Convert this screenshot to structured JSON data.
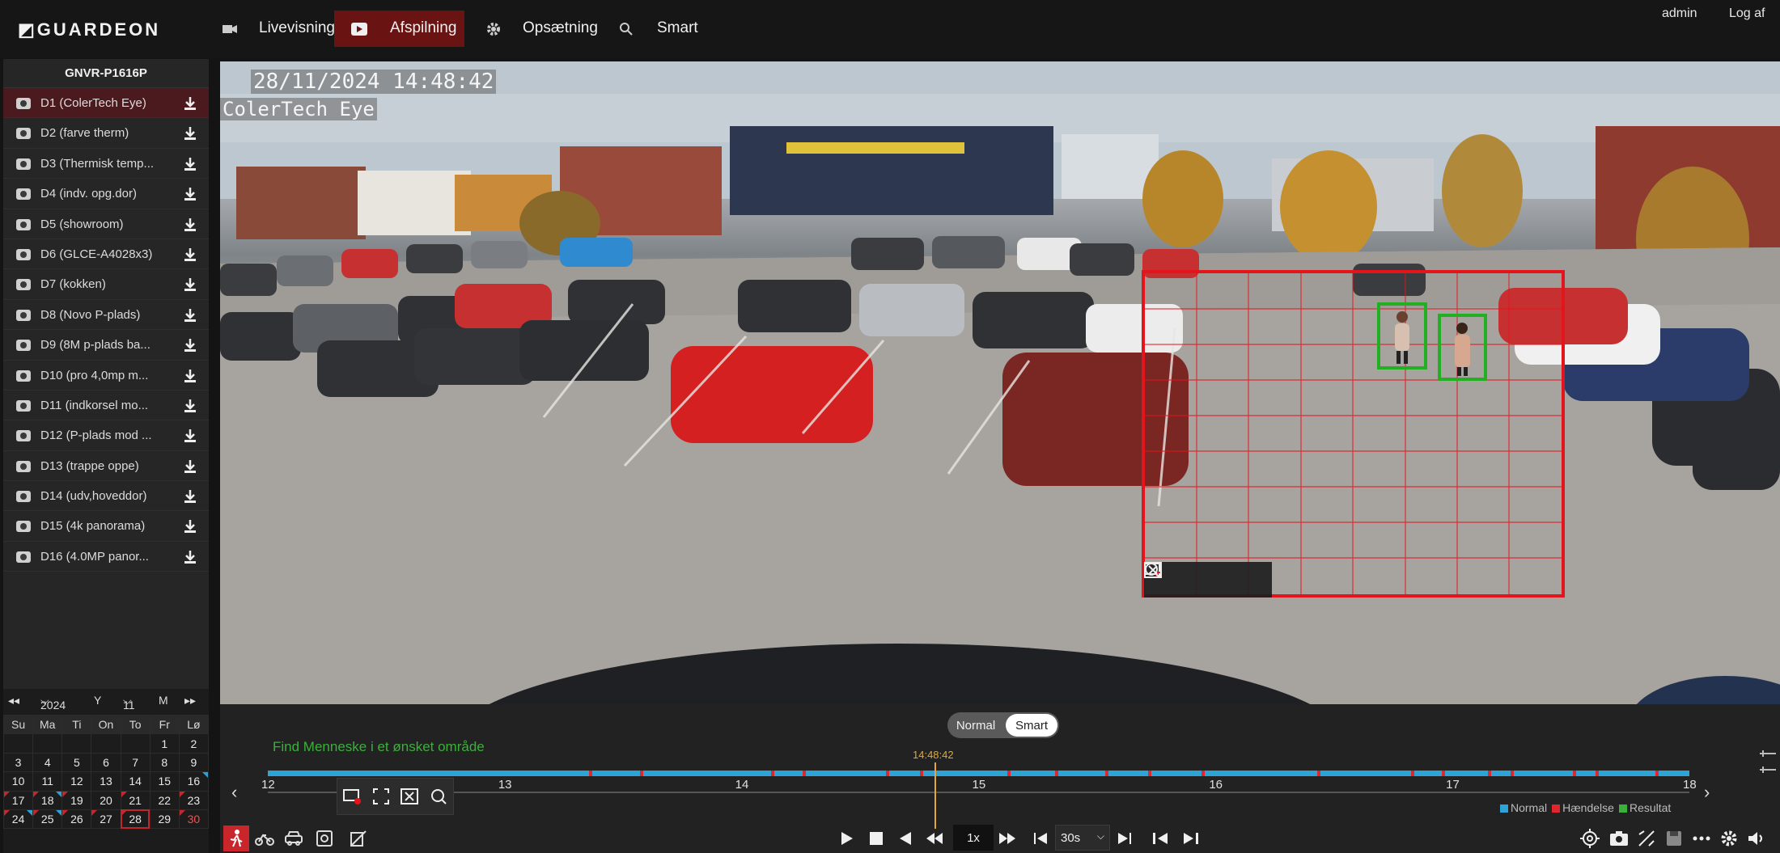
{
  "app": {
    "logo": "GUARDEON"
  },
  "nav": {
    "live": "Livevisning",
    "playback": "Afspilning",
    "setup": "Opsætning",
    "smart": "Smart"
  },
  "user": {
    "name": "admin",
    "logout": "Log af"
  },
  "sidebar": {
    "device": "GNVR-P1616P",
    "channels": [
      {
        "label": "D1 (ColerTech Eye)"
      },
      {
        "label": "D2 (farve therm)"
      },
      {
        "label": "D3 (Thermisk temp..."
      },
      {
        "label": "D4 (indv. opg.dor)"
      },
      {
        "label": "D5 (showroom)"
      },
      {
        "label": "D6 (GLCE-A4028x3)"
      },
      {
        "label": "D7 (kokken)"
      },
      {
        "label": "D8 (Novo P-plads)"
      },
      {
        "label": "D9 (8M p-plads ba..."
      },
      {
        "label": "D10 (pro 4,0mp m..."
      },
      {
        "label": "D11 (indkorsel mo..."
      },
      {
        "label": "D12 (P-plads mod ..."
      },
      {
        "label": "D13 (trappe oppe)"
      },
      {
        "label": "D14 (udv,hoveddor)"
      },
      {
        "label": "D15 (4k panorama)"
      },
      {
        "label": "D16 (4.0MP panor..."
      }
    ]
  },
  "calendar": {
    "year": "2024",
    "year_unit": "Y",
    "month": "11",
    "month_unit": "M",
    "weekdays": [
      "Su",
      "Ma",
      "Ti",
      "On",
      "To",
      "Fr",
      "Lø"
    ],
    "weeks": [
      [
        "",
        "",
        "",
        "",
        "",
        "1",
        "2"
      ],
      [
        "3",
        "4",
        "5",
        "6",
        "7",
        "8",
        "9"
      ],
      [
        "10",
        "11",
        "12",
        "13",
        "14",
        "15",
        "16"
      ],
      [
        "17",
        "18",
        "19",
        "20",
        "21",
        "22",
        "23"
      ],
      [
        "24",
        "25",
        "26",
        "27",
        "28",
        "29",
        "30"
      ]
    ],
    "selected_day": "28"
  },
  "video": {
    "osd_time": "28/11/2024 14:48:42",
    "osd_name": "ColerTech Eye",
    "detections": 2
  },
  "timeline": {
    "mode_normal": "Normal",
    "mode_smart": "Smart",
    "hint": "Find Menneske i et ønsket område",
    "cursor_time": "14:48:42",
    "hours": [
      "12",
      "13",
      "14",
      "15",
      "16",
      "17",
      "18"
    ],
    "legend": {
      "normal": "Normal",
      "event": "Hændelse",
      "result": "Resultat"
    },
    "speed": "1x",
    "seek_step": "30s"
  },
  "colors": {
    "accent_red": "#c9262c",
    "normal": "#2ea3d6",
    "event": "#e0262c",
    "result": "#3bb03b",
    "search_area": "#e3141c"
  }
}
